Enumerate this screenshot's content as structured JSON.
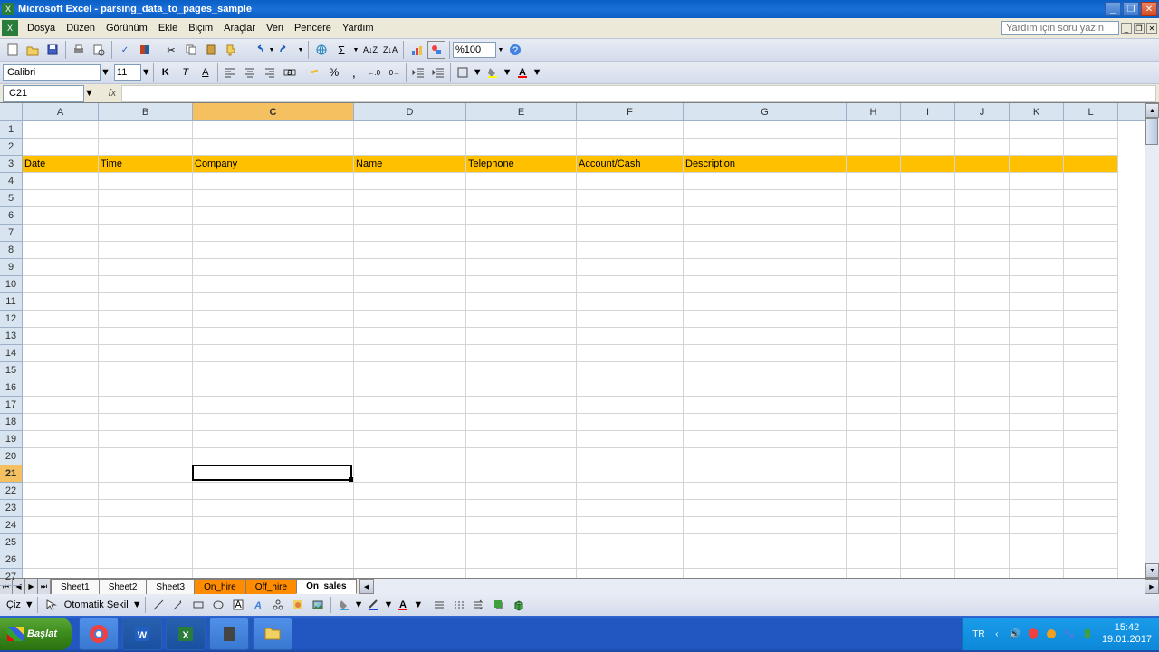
{
  "titlebar": {
    "title": "Microsoft Excel - parsing_data_to_pages_sample"
  },
  "menu": {
    "items": [
      "Dosya",
      "Düzen",
      "Görünüm",
      "Ekle",
      "Biçim",
      "Araçlar",
      "Veri",
      "Pencere",
      "Yardım"
    ],
    "help_placeholder": "Yardım için soru yazın"
  },
  "toolbar": {
    "zoom": "%100"
  },
  "format": {
    "font": "Calibri",
    "size": "11"
  },
  "formula": {
    "cell_ref": "C21",
    "value": ""
  },
  "columns": [
    {
      "letter": "A",
      "width": 84
    },
    {
      "letter": "B",
      "width": 104
    },
    {
      "letter": "C",
      "width": 178
    },
    {
      "letter": "D",
      "width": 124
    },
    {
      "letter": "E",
      "width": 122
    },
    {
      "letter": "F",
      "width": 118
    },
    {
      "letter": "G",
      "width": 180
    },
    {
      "letter": "H",
      "width": 60
    },
    {
      "letter": "I",
      "width": 60
    },
    {
      "letter": "J",
      "width": 60
    },
    {
      "letter": "K",
      "width": 60
    },
    {
      "letter": "L",
      "width": 60
    }
  ],
  "rows": 27,
  "header_row": 3,
  "headers": [
    "Date",
    "Time",
    "Company",
    "Name",
    "Telephone",
    "Account/Cash",
    "Description"
  ],
  "selected": {
    "col": "C",
    "row": 21
  },
  "tabs": {
    "nav": [
      "⏮",
      "◀",
      "▶",
      "⏭"
    ],
    "sheets": [
      {
        "name": "Sheet1",
        "colored": false,
        "active": false
      },
      {
        "name": "Sheet2",
        "colored": false,
        "active": false
      },
      {
        "name": "Sheet3",
        "colored": false,
        "active": false
      },
      {
        "name": "On_hire",
        "colored": true,
        "active": false
      },
      {
        "name": "Off_hire",
        "colored": true,
        "active": false
      },
      {
        "name": "On_sales",
        "colored": false,
        "active": true
      }
    ]
  },
  "drawbar": {
    "draw": "Çiz",
    "autoshapes": "Otomatik Şekil"
  },
  "taskbar": {
    "start": "Başlat",
    "lang": "TR",
    "time": "15:42",
    "date": "19.01.2017"
  }
}
